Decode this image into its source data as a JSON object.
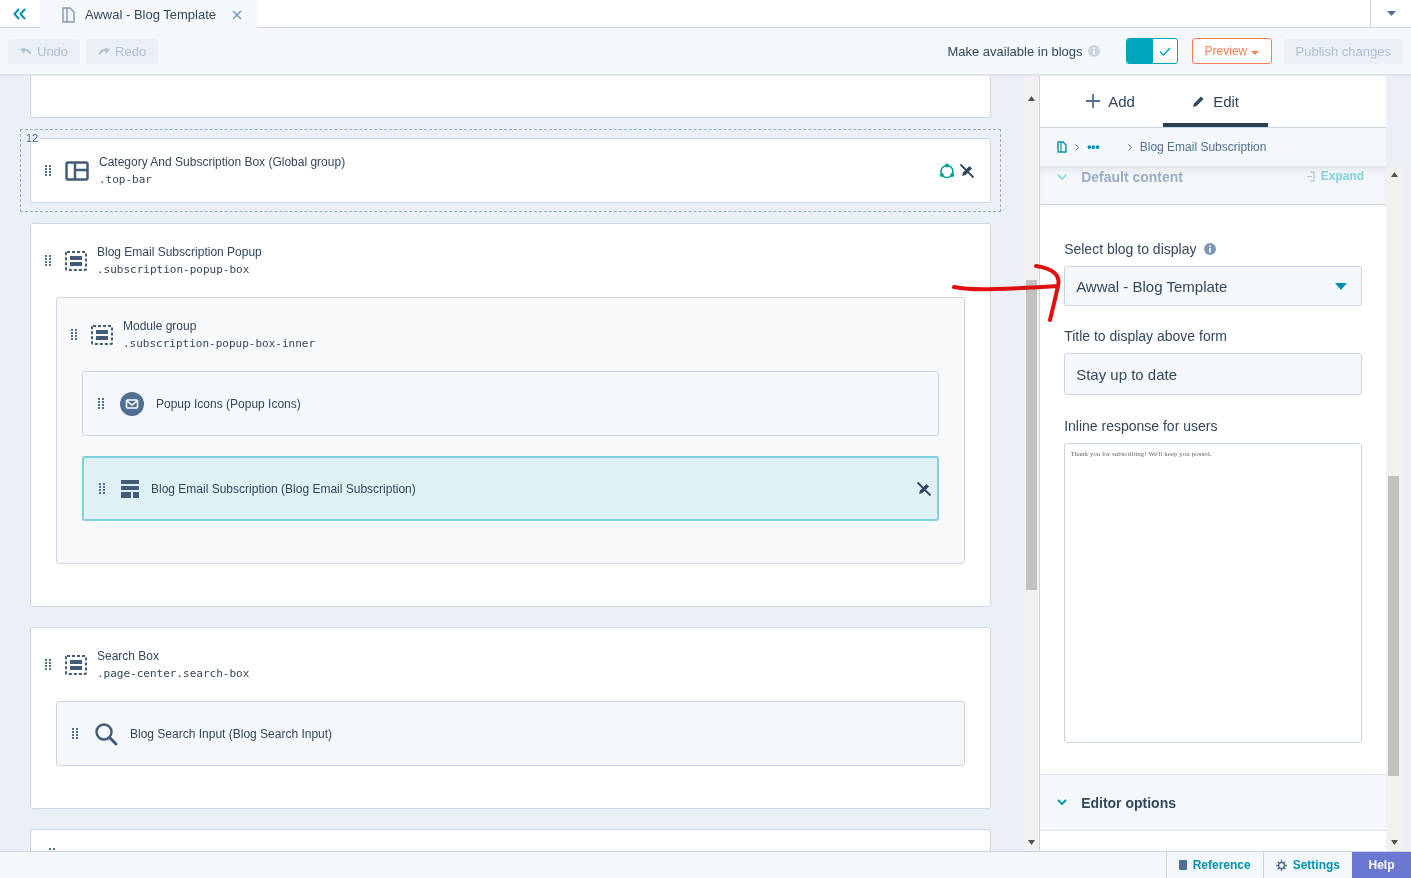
{
  "tab": {
    "title": "Awwal - Blog Template"
  },
  "toolbar": {
    "undo": "Undo",
    "redo": "Redo",
    "availability_label": "Make available in blogs",
    "available": true,
    "preview": "Preview",
    "publish": "Publish changes"
  },
  "canvas": {
    "items": [
      {
        "kind": "stub"
      },
      {
        "kind": "layout_group",
        "number": "12",
        "title": "Category And Subscription Box (Global group)",
        "selector": ".top-bar",
        "global": true,
        "locked": true
      },
      {
        "kind": "group",
        "title": "Blog Email Subscription Popup",
        "selector": ".subscription-popup-box",
        "children": [
          {
            "kind": "group",
            "title": "Module group",
            "selector": ".subscription-popup-box-inner",
            "children": [
              {
                "kind": "mail_module",
                "title": "Popup Icons (Popup Icons)",
                "selected": false
              },
              {
                "kind": "form_module",
                "title": "Blog Email Subscription (Blog Email Subscription)",
                "selected": true,
                "locked": true
              }
            ]
          }
        ]
      },
      {
        "kind": "group",
        "title": "Search Box",
        "selector": ".page-center.search-box",
        "children": [
          {
            "kind": "search_module",
            "title": "Blog Search Input (Blog Search Input)",
            "selected": false
          }
        ]
      },
      {
        "kind": "stub_group"
      }
    ]
  },
  "panel": {
    "tabs": [
      {
        "kind": "add",
        "label": "Add",
        "selected": false
      },
      {
        "kind": "edit",
        "label": "Edit",
        "selected": true
      }
    ],
    "breadcrumb": {
      "ellipsis": "•••",
      "current": "Blog Email Subscription"
    },
    "section": {
      "title": "Default content",
      "expand": "Expand",
      "expanded": true
    },
    "fields": [
      {
        "kind": "select",
        "label": "Select blog to display",
        "info": true,
        "value": "Awwal - Blog Template"
      },
      {
        "kind": "input",
        "label": "Title to display above form",
        "value": "Stay up to date"
      },
      {
        "kind": "textarea",
        "label": "Inline response for users",
        "value": "Thank you for subscribing! We'll keep you posted."
      }
    ],
    "editor_options": {
      "title": "Editor options",
      "expanded": false
    }
  },
  "footer": {
    "reference": "Reference",
    "settings": "Settings",
    "help": "Help"
  }
}
